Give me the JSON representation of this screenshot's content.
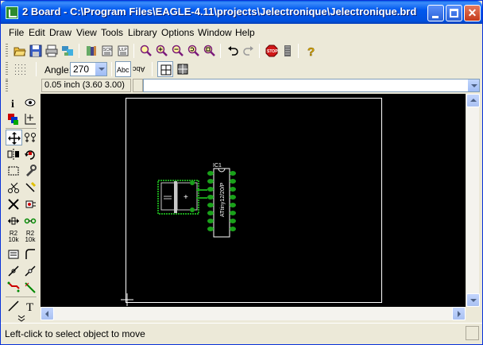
{
  "window": {
    "title": "2 Board - C:\\Program Files\\EAGLE-4.11\\projects\\Jelectronique\\Jelectronique.brd",
    "controls": {
      "minimize": "minimize",
      "maximize": "maximize",
      "close": "✕"
    }
  },
  "menu": [
    "File",
    "Edit",
    "Draw",
    "View",
    "Tools",
    "Library",
    "Options",
    "Window",
    "Help"
  ],
  "toolbar_top": {
    "icons": [
      "open-icon",
      "save-icon",
      "print-icon",
      "cam-icon",
      "library-icon",
      "script-icon",
      "ulp-icon",
      "zoom-fit-icon",
      "zoom-in-icon",
      "zoom-out-icon",
      "zoom-redraw-icon",
      "zoom-select-icon",
      "undo-icon",
      "redo-icon",
      "stop-icon",
      "go-icon",
      "help-icon"
    ]
  },
  "toolbar_params": {
    "angle_label": "Angle:",
    "angle_value": "270",
    "mirror_text": "Abc",
    "spin_text": "Abc"
  },
  "coordbar": {
    "coordinates": "0.05 inch (3.60 3.00)",
    "command_value": ""
  },
  "palette": {
    "tools": [
      "info",
      "show",
      "display",
      "mark",
      "move",
      "copy",
      "mirror",
      "rotate",
      "group",
      "change",
      "paste",
      "delete",
      "add",
      "pinswap",
      "replace",
      "lock",
      "split",
      "optimize",
      "name",
      "value",
      "smash",
      "miter",
      "route",
      "ripup",
      "wire",
      "text"
    ],
    "name_label": "R2",
    "name_sub": "10k",
    "value_label": "R2",
    "value_sub": "10k"
  },
  "board": {
    "ic_name": "IC1",
    "ic_value": "ATtiny12/20/P",
    "cap_plus": "+",
    "outline_color": "#ffffff",
    "pad_color": "#1aa01a",
    "background": "#000000"
  },
  "status": {
    "message": "Left-click to select object to move"
  }
}
